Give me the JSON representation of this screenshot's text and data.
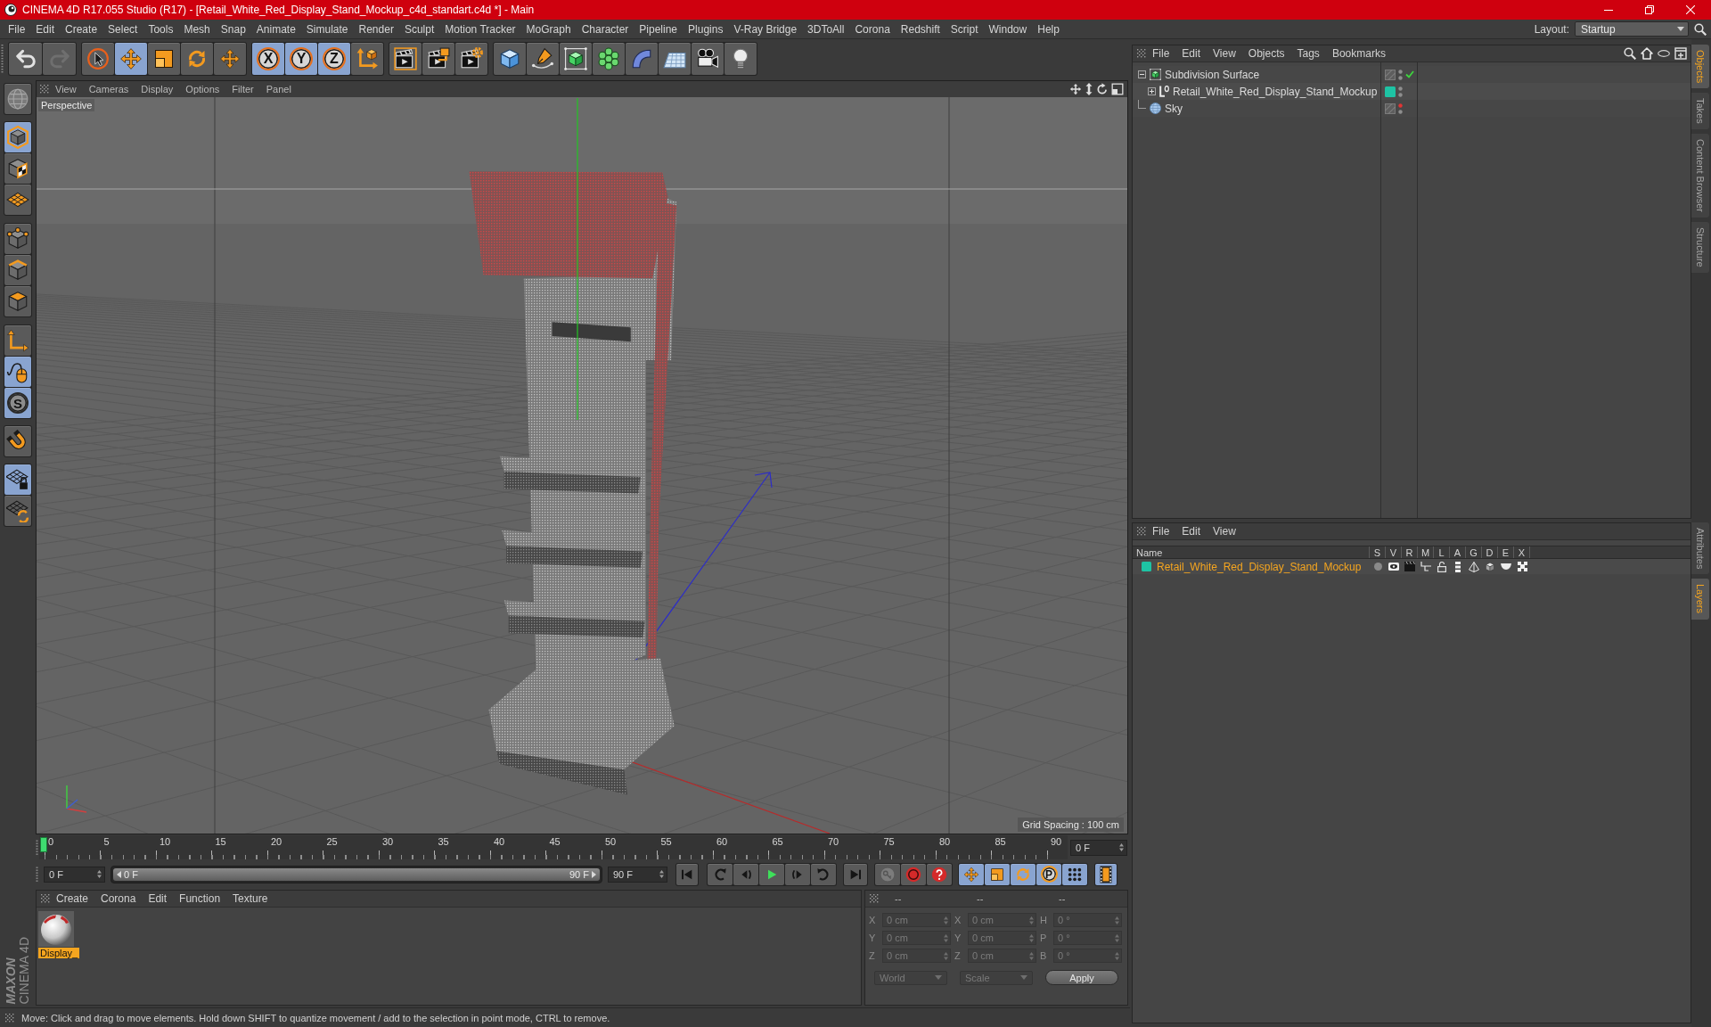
{
  "window": {
    "title": "CINEMA 4D R17.055 Studio (R17) - [Retail_White_Red_Display_Stand_Mockup_c4d_standart.c4d *] - Main"
  },
  "menu": [
    "File",
    "Edit",
    "Create",
    "Select",
    "Tools",
    "Mesh",
    "Snap",
    "Animate",
    "Simulate",
    "Render",
    "Sculpt",
    "Motion Tracker",
    "MoGraph",
    "Character",
    "Pipeline",
    "Plugins",
    "V-Ray Bridge",
    "3DToAll",
    "Corona",
    "Redshift",
    "Script",
    "Window",
    "Help"
  ],
  "layout": {
    "label": "Layout:",
    "value": "Startup"
  },
  "toolbar": {
    "history": [
      {
        "disabled": false
      },
      {
        "disabled": true
      }
    ],
    "tools": [
      {
        "selected": false
      },
      {
        "selected": true
      },
      {
        "selected": false
      },
      {
        "selected": false
      },
      {
        "selected": false
      }
    ],
    "axes": [
      {
        "label": "X",
        "selected": true
      },
      {
        "label": "Y",
        "selected": true
      },
      {
        "label": "Z",
        "selected": true
      }
    ],
    "coordinate_system": {
      "selected": false
    },
    "render": [
      {
        "selected": false
      },
      {
        "selected": false
      },
      {
        "selected": false
      }
    ],
    "objects": [
      {
        "selected": false
      },
      {
        "selected": false
      },
      {
        "selected": false
      },
      {
        "selected": false
      },
      {
        "selected": false
      },
      {
        "selected": false
      },
      {
        "selected": false
      },
      {
        "selected": false
      }
    ]
  },
  "modes": [
    [
      {
        "selected": false
      }
    ],
    [
      {
        "selected": true
      },
      {
        "selected": false
      },
      {
        "selected": false
      }
    ],
    [
      {
        "selected": false
      },
      {
        "selected": false
      },
      {
        "selected": false
      }
    ],
    [
      {
        "selected": false
      },
      {
        "selected": true
      },
      {
        "selected": true,
        "label": "S"
      }
    ],
    [
      {
        "selected": false
      }
    ],
    [
      {
        "selected": true
      },
      {
        "selected": false
      }
    ]
  ],
  "viewport": {
    "menu": [
      "View",
      "Cameras",
      "Display",
      "Options",
      "Filter",
      "Panel"
    ],
    "camera": "Perspective",
    "grid_spacing": "Grid Spacing : 100 cm"
  },
  "timeline": {
    "ticks": [
      "0",
      "5",
      "10",
      "15",
      "20",
      "25",
      "30",
      "35",
      "40",
      "45",
      "50",
      "55",
      "60",
      "65",
      "70",
      "75",
      "80",
      "85",
      "90"
    ],
    "playhead": {
      "level": 0
    },
    "current_frame": "0 F"
  },
  "transport": {
    "start": "0 F",
    "range": {
      "start": "0 F",
      "end": "90 F",
      "level": 1
    },
    "end": "90 F",
    "keys": [
      {
        "selected": true
      },
      {
        "selected": true
      },
      {
        "selected": true
      },
      {
        "label": "P",
        "selected": true
      },
      {
        "selected": true
      }
    ],
    "timeline_button": {
      "selected": true
    }
  },
  "materials": {
    "menu": [
      "Create",
      "Corona",
      "Edit",
      "Function",
      "Texture"
    ],
    "items": [
      {
        "name": "Display_",
        "selected": true
      }
    ]
  },
  "coordinates": {
    "headers": [
      "--",
      "--",
      "--"
    ],
    "disabled": true,
    "rows": [
      {
        "position": {
          "axis": "X",
          "value": "0 cm"
        },
        "size": {
          "axis": "X",
          "value": "0 cm"
        },
        "rotation": {
          "axis": "H",
          "value": "0 °"
        }
      },
      {
        "position": {
          "axis": "Y",
          "value": "0 cm"
        },
        "size": {
          "axis": "Y",
          "value": "0 cm"
        },
        "rotation": {
          "axis": "P",
          "value": "0 °"
        }
      },
      {
        "position": {
          "axis": "Z",
          "value": "0 cm"
        },
        "size": {
          "axis": "Z",
          "value": "0 cm"
        },
        "rotation": {
          "axis": "B",
          "value": "0 °"
        }
      }
    ],
    "mode": "World",
    "size_mode": "Scale",
    "apply": "Apply"
  },
  "status": "Move: Click and drag to move elements. Hold down SHIFT to quantize movement / add to the selection in point mode, CTRL to remove.",
  "objects": {
    "menu": [
      "File",
      "Edit",
      "View",
      "Objects",
      "Tags",
      "Bookmarks"
    ],
    "tree": [
      {
        "kind": "subdivision",
        "name": "Subdivision Surface",
        "expanded": true,
        "enabled": true,
        "hidden_in_editor": false,
        "hidden_in_render": false,
        "children": [
          {
            "kind": "null",
            "name": "Retail_White_Red_Display_Stand_Mockup",
            "expanded": false,
            "color": "#1ec3a4",
            "hidden_in_editor": false,
            "hidden_in_render": false
          }
        ]
      },
      {
        "kind": "sky",
        "name": "Sky",
        "hidden_in_editor": true,
        "hidden_in_render": false
      }
    ]
  },
  "layers": {
    "menu": [
      "File",
      "Edit",
      "View"
    ],
    "columns": [
      "Name",
      "S",
      "V",
      "R",
      "M",
      "L",
      "A",
      "G",
      "D",
      "E",
      "X"
    ],
    "rows": [
      {
        "name": "Retail_White_Red_Display_Stand_Mockup",
        "color": "#1ec3a4"
      }
    ]
  },
  "side_tabs": {
    "upper": [
      {
        "label": "Objects",
        "selected": true
      },
      {
        "label": "Takes",
        "selected": false
      },
      {
        "label": "Content Browser",
        "selected": false
      },
      {
        "label": "Structure",
        "selected": false
      }
    ],
    "lower": [
      {
        "label": "Attributes",
        "selected": false
      },
      {
        "label": "Layers",
        "selected": true
      }
    ]
  },
  "brand": {
    "maker": "MAXON",
    "product": "CINEMA 4D"
  }
}
